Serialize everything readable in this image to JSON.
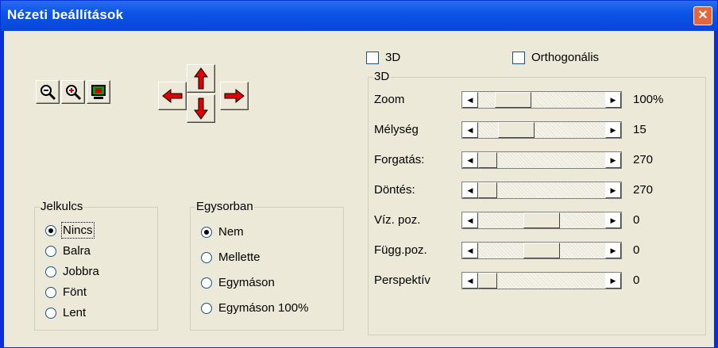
{
  "window": {
    "title": "Nézeti beállítások"
  },
  "toolbar": {
    "zoom_out": "zoom-out-icon",
    "zoom_in": "zoom-in-icon",
    "fit_view": "monitor-icon",
    "arrows": [
      "arrow-up-icon",
      "arrow-left-icon",
      "arrow-right-icon",
      "arrow-down-icon"
    ]
  },
  "options": {
    "three_d": {
      "label": "3D",
      "checked": false
    },
    "orthogonal": {
      "label": "Orthogonális",
      "checked": false
    }
  },
  "group3d": {
    "title": "3D",
    "rows": [
      {
        "label": "Zoom",
        "value": "100%",
        "position": 0.18
      },
      {
        "label": "Mélység",
        "value": "15",
        "position": 0.22
      },
      {
        "label": "Forgatás:",
        "value": "270",
        "position": 0.0
      },
      {
        "label": "Döntés:",
        "value": "270",
        "position": 0.0
      },
      {
        "label": "Víz. poz.",
        "value": "0",
        "position": 0.5
      },
      {
        "label": "Függ.poz.",
        "value": "0",
        "position": 0.5
      },
      {
        "label": "Perspektív",
        "value": "0",
        "position": 0.0
      }
    ]
  },
  "legend_group": {
    "title": "Jelkulcs",
    "options": [
      "Nincs",
      "Balra",
      "Jobbra",
      "Fönt",
      "Lent"
    ],
    "selected": "Nincs"
  },
  "inline_group": {
    "title": "Egysorban",
    "options": [
      "Nem",
      "Mellette",
      "Egymáson",
      "Egymáson 100%"
    ],
    "selected": "Nem"
  },
  "colors": {
    "title_bar": "#0846d8",
    "dialog_bg": "#ece9d8",
    "arrow_red": "#e00000",
    "close": "#e5653c"
  }
}
